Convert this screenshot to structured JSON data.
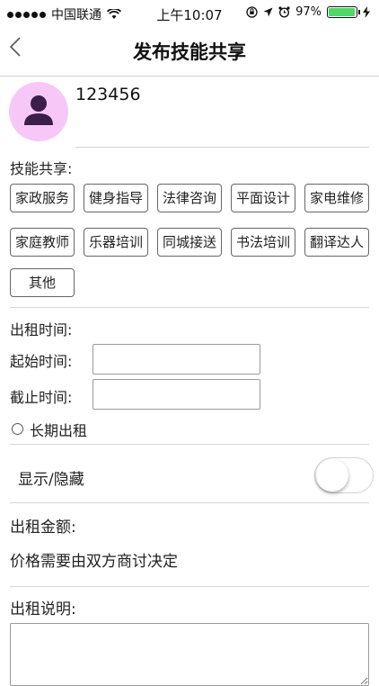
{
  "status_bar": {
    "carrier": "中国联通",
    "time": "上午10:07",
    "battery": "97%",
    "battery_level": 0.97,
    "signal_icon": "signal-dots-icon",
    "wifi_icon": "wifi-icon",
    "colors": {
      "battery": "#4cd964"
    }
  },
  "nav": {
    "back_icon": "chevron-left-icon",
    "title": "发布技能共享"
  },
  "profile": {
    "avatar_icon": "person-icon",
    "username": "123456",
    "colors": {
      "avatar_bg": "#f7c8f7",
      "avatar_fg": "#3b1f4b"
    }
  },
  "skills": {
    "label": "技能共享:",
    "items": [
      "家政服务",
      "健身指导",
      "法律咨询",
      "平面设计",
      "家电维修",
      "家庭教师",
      "乐器培训",
      "同城接送",
      "书法培训",
      "翻译达人",
      "其他"
    ]
  },
  "rental_time": {
    "label": "出租时间:",
    "start_label": "起始时间:",
    "start_value": "",
    "end_label": "截止时间:",
    "end_value": "",
    "long_term_label": "长期出租",
    "long_term_checked": false
  },
  "visibility": {
    "label": "显示/隐藏",
    "enabled": false
  },
  "price": {
    "label": "出租金额:",
    "note": "价格需要由双方商讨决定"
  },
  "description": {
    "label": "出租说明:",
    "value": ""
  }
}
